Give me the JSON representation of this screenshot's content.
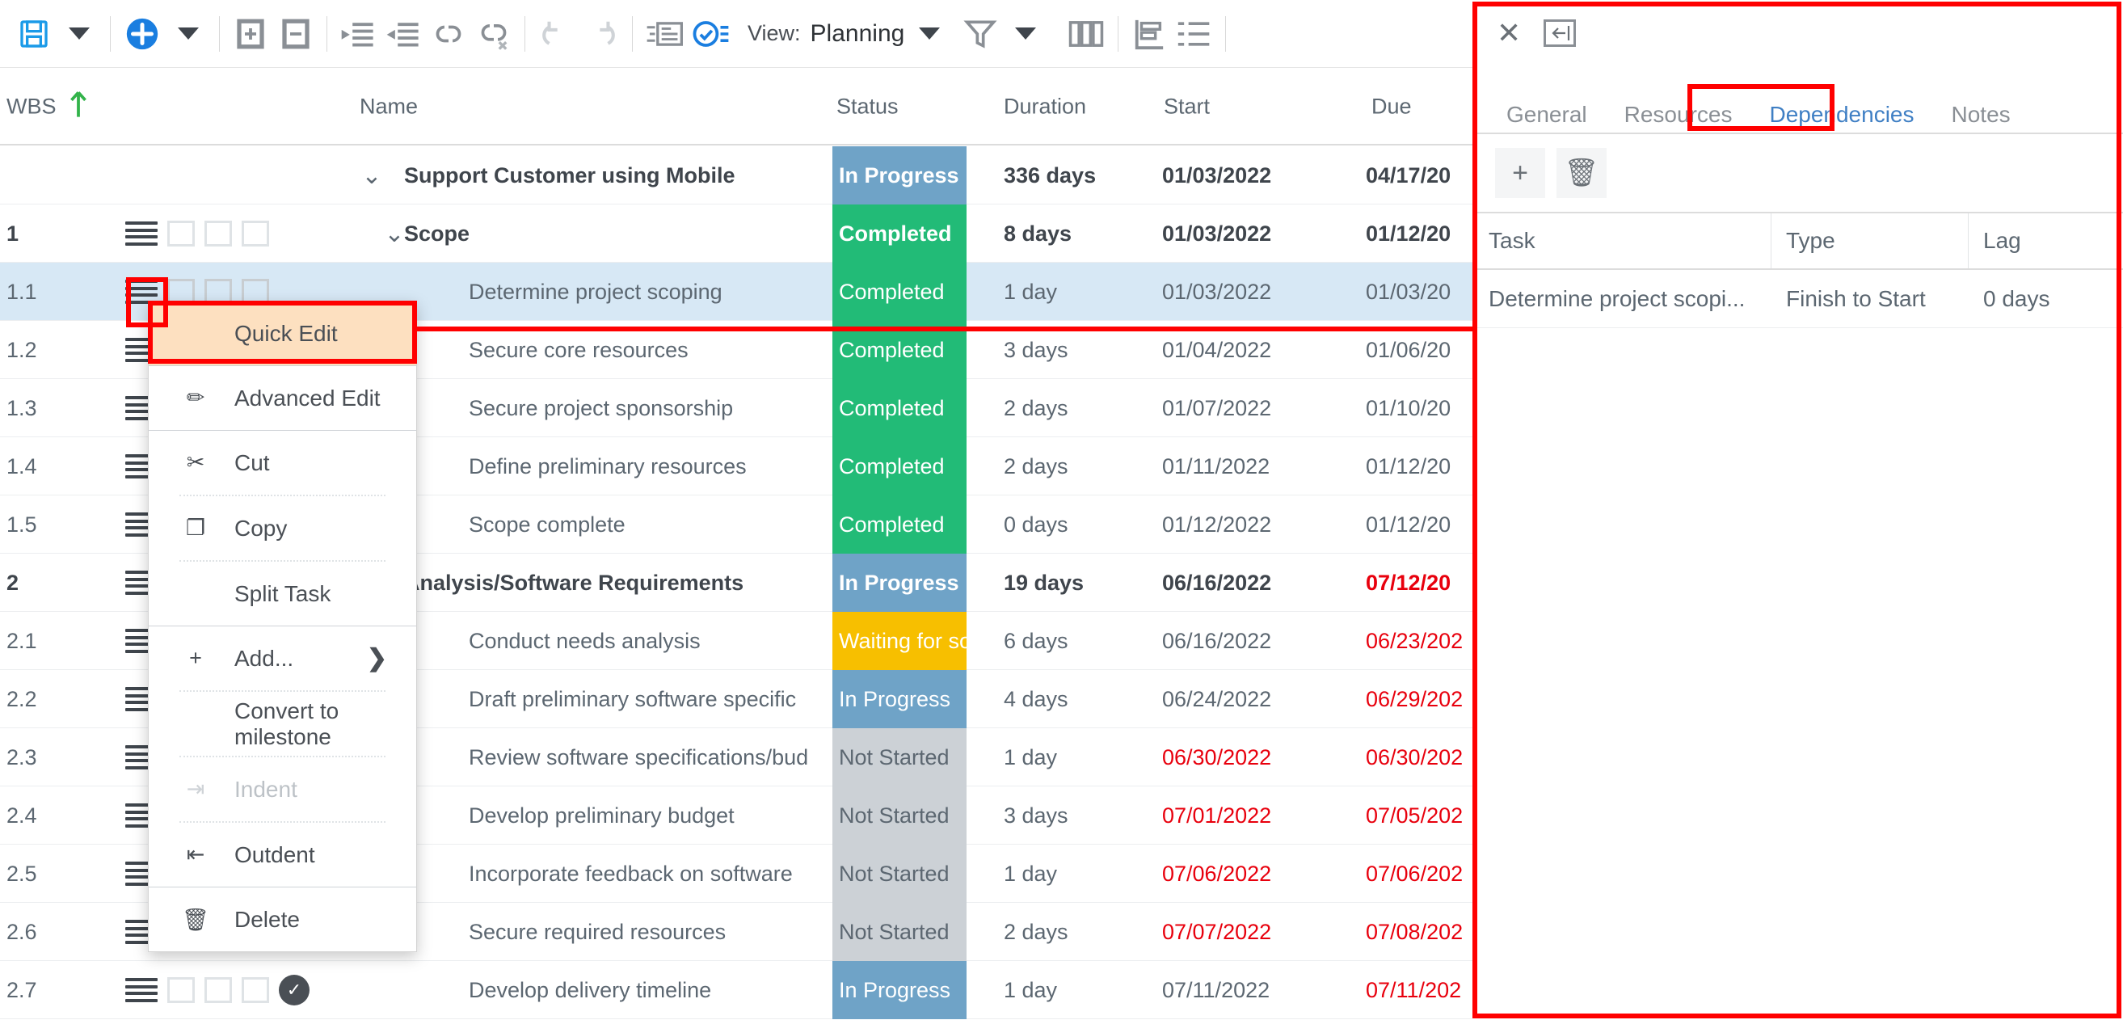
{
  "toolbar": {
    "save_label": "save-disk",
    "save_dropdown": "caret-down",
    "add_label": "add-circle",
    "add_dropdown": "caret-down",
    "expand_all": "expand-all",
    "collapse_all": "collapse-all",
    "outdent": "outdent",
    "indent": "indent",
    "link": "link-tasks",
    "unlink": "unlink-tasks",
    "undo": "undo",
    "redo": "redo",
    "notes": "notes",
    "checklist": "checklist",
    "view_label": "View:",
    "view_value": "Planning",
    "filter": "filter",
    "filter_caret": "caret-down",
    "columns": "columns",
    "baseline": "baseline",
    "outline": "outline"
  },
  "table": {
    "columns": [
      "WBS",
      "Name",
      "Status",
      "Duration",
      "Start",
      "Due"
    ],
    "sort_indicator": "ascending-arrow",
    "rows": [
      {
        "wbs": "",
        "name": "Support Customer using Mobile",
        "group": true,
        "chevron": "v",
        "chevron_indent": 0,
        "status": "In Progress",
        "status_class": "st-inprogress",
        "duration": "336 days",
        "start": "01/03/2022",
        "due": "04/17/20",
        "due_overdue": false,
        "selected": false,
        "icons": false,
        "done": false
      },
      {
        "wbs": "1",
        "name": "Scope",
        "group": true,
        "chevron": "v",
        "chevron_indent": 28,
        "status": "Completed",
        "status_class": "st-completed",
        "duration": "8 days",
        "start": "01/03/2022",
        "due": "01/12/20",
        "due_overdue": false,
        "selected": false,
        "icons": true,
        "done": false
      },
      {
        "wbs": "1.1",
        "name": "Determine project scoping",
        "group": false,
        "chevron": "",
        "chevron_indent": 0,
        "status": "Completed",
        "status_class": "st-completed",
        "duration": "1 day",
        "start": "01/03/2022",
        "due": "01/03/20",
        "due_overdue": false,
        "selected": true,
        "icons": true,
        "done": false
      },
      {
        "wbs": "1.2",
        "name": "Secure core resources",
        "group": false,
        "chevron": "",
        "chevron_indent": 0,
        "status": "Completed",
        "status_class": "st-completed",
        "duration": "3 days",
        "start": "01/04/2022",
        "due": "01/06/20",
        "due_overdue": false,
        "selected": false,
        "icons": true,
        "done": false
      },
      {
        "wbs": "1.3",
        "name": "Secure project sponsorship",
        "group": false,
        "chevron": "",
        "chevron_indent": 0,
        "status": "Completed",
        "status_class": "st-completed",
        "duration": "2 days",
        "start": "01/07/2022",
        "due": "01/10/20",
        "due_overdue": false,
        "selected": false,
        "icons": true,
        "done": false
      },
      {
        "wbs": "1.4",
        "name": "Define preliminary resources",
        "group": false,
        "chevron": "",
        "chevron_indent": 0,
        "status": "Completed",
        "status_class": "st-completed",
        "duration": "2 days",
        "start": "01/11/2022",
        "due": "01/12/20",
        "due_overdue": false,
        "selected": false,
        "icons": true,
        "done": false
      },
      {
        "wbs": "1.5",
        "name": "Scope complete",
        "group": false,
        "chevron": "",
        "chevron_indent": 0,
        "status": "Completed",
        "status_class": "st-completed",
        "duration": "0 days",
        "start": "01/12/2022",
        "due": "01/12/20",
        "due_overdue": false,
        "selected": false,
        "icons": true,
        "done": false
      },
      {
        "wbs": "2",
        "name": "Analysis/Software Requirements",
        "group": true,
        "chevron": "v",
        "chevron_indent": 28,
        "status": "In Progress",
        "status_class": "st-inprogress",
        "duration": "19 days",
        "start": "06/16/2022",
        "due": "07/12/20",
        "due_overdue": true,
        "selected": false,
        "icons": true,
        "done": false
      },
      {
        "wbs": "2.1",
        "name": "Conduct needs analysis",
        "group": false,
        "chevron": "",
        "chevron_indent": 0,
        "status": "Waiting for some",
        "status_class": "st-waiting",
        "duration": "6 days",
        "start": "06/16/2022",
        "due": "06/23/202",
        "due_overdue": true,
        "selected": false,
        "icons": true,
        "done": false
      },
      {
        "wbs": "2.2",
        "name": "Draft preliminary software specific",
        "group": false,
        "chevron": "",
        "chevron_indent": 0,
        "status": "In Progress",
        "status_class": "st-inprogress",
        "duration": "4 days",
        "start": "06/24/2022",
        "due": "06/29/202",
        "due_overdue": true,
        "selected": false,
        "icons": true,
        "done": false
      },
      {
        "wbs": "2.3",
        "name": "Review software specifications/bud",
        "group": false,
        "chevron": "",
        "chevron_indent": 0,
        "status": "Not Started",
        "status_class": "st-notstarted",
        "duration": "1 day",
        "start": "06/30/2022",
        "due": "06/30/202",
        "due_overdue": true,
        "start_overdue": true,
        "selected": false,
        "icons": true,
        "done": false
      },
      {
        "wbs": "2.4",
        "name": "Develop preliminary budget",
        "group": false,
        "chevron": "",
        "chevron_indent": 0,
        "status": "Not Started",
        "status_class": "st-notstarted",
        "duration": "3 days",
        "start": "07/01/2022",
        "due": "07/05/202",
        "due_overdue": true,
        "start_overdue": true,
        "selected": false,
        "icons": true,
        "done": false
      },
      {
        "wbs": "2.5",
        "name": "Incorporate feedback on software",
        "group": false,
        "chevron": "",
        "chevron_indent": 0,
        "status": "Not Started",
        "status_class": "st-notstarted",
        "duration": "1 day",
        "start": "07/06/2022",
        "due": "07/06/202",
        "due_overdue": true,
        "start_overdue": true,
        "selected": false,
        "icons": true,
        "done": false
      },
      {
        "wbs": "2.6",
        "name": "Secure required resources",
        "group": false,
        "chevron": "",
        "chevron_indent": 0,
        "status": "Not Started",
        "status_class": "st-notstarted",
        "duration": "2 days",
        "start": "07/07/2022",
        "due": "07/08/202",
        "due_overdue": true,
        "start_overdue": true,
        "selected": false,
        "icons": true,
        "done": false
      },
      {
        "wbs": "2.7",
        "name": "Develop delivery timeline",
        "group": false,
        "chevron": "",
        "chevron_indent": 0,
        "status": "In Progress",
        "status_class": "st-inprogress",
        "duration": "1 day",
        "start": "07/11/2022",
        "due": "07/11/202",
        "due_overdue": true,
        "selected": false,
        "icons": true,
        "done": true
      }
    ]
  },
  "context_menu": {
    "items": [
      {
        "label": "Quick Edit",
        "icon": "",
        "highlight": true,
        "disabled": false,
        "submenu": false,
        "sep_after": "solid"
      },
      {
        "label": "Advanced Edit",
        "icon": "pencil-icon",
        "glyph": "✏",
        "highlight": false,
        "disabled": false,
        "submenu": false,
        "sep_after": "solid"
      },
      {
        "label": "Cut",
        "icon": "scissors-icon",
        "glyph": "✂",
        "highlight": false,
        "disabled": false,
        "submenu": false,
        "sep_after": "dot"
      },
      {
        "label": "Copy",
        "icon": "copy-icon",
        "glyph": "❐",
        "highlight": false,
        "disabled": false,
        "submenu": false,
        "sep_after": "dot"
      },
      {
        "label": "Split Task",
        "icon": "",
        "glyph": "",
        "highlight": false,
        "disabled": false,
        "submenu": false,
        "sep_after": "solid"
      },
      {
        "label": "Add...",
        "icon": "plus-icon",
        "glyph": "+",
        "highlight": false,
        "disabled": false,
        "submenu": true,
        "sep_after": "dot"
      },
      {
        "label": "Convert to milestone",
        "icon": "",
        "glyph": "",
        "highlight": false,
        "disabled": false,
        "submenu": false,
        "sep_after": "dot"
      },
      {
        "label": "Indent",
        "icon": "indent-icon",
        "glyph": "⇥",
        "highlight": false,
        "disabled": true,
        "submenu": false,
        "sep_after": "dot"
      },
      {
        "label": "Outdent",
        "icon": "outdent-icon",
        "glyph": "⇤",
        "highlight": false,
        "disabled": false,
        "submenu": false,
        "sep_after": "solid"
      },
      {
        "label": "Delete",
        "icon": "trash-icon",
        "glyph": "🗑",
        "highlight": false,
        "disabled": false,
        "submenu": false,
        "sep_after": "none"
      }
    ]
  },
  "right_panel": {
    "close_label": "✕",
    "collapse_label": "←|",
    "tabs": [
      {
        "label": "General",
        "active": false
      },
      {
        "label": "Resources",
        "active": false
      },
      {
        "label": "Dependencies",
        "active": true
      },
      {
        "label": "Notes",
        "active": false
      }
    ],
    "actions": [
      {
        "name": "add-dependency-button",
        "glyph": "+"
      },
      {
        "name": "delete-dependency-button",
        "glyph": "🗑"
      }
    ],
    "columns": [
      "Task",
      "Type",
      "Lag"
    ],
    "rows": [
      {
        "task": "Determine project scopi...",
        "type": "Finish to Start",
        "lag": "0 days"
      }
    ]
  },
  "colors": {
    "accent": "#1a85e0",
    "in_progress": "#6fa3c7",
    "completed": "#22bb77",
    "waiting": "#f7bf00",
    "not_started": "#ccd1d6",
    "overdue_text": "#e8000d",
    "selection": "#d7e8f5",
    "highlight_menu": "#fde0c0",
    "annotation": "#ff0000"
  }
}
